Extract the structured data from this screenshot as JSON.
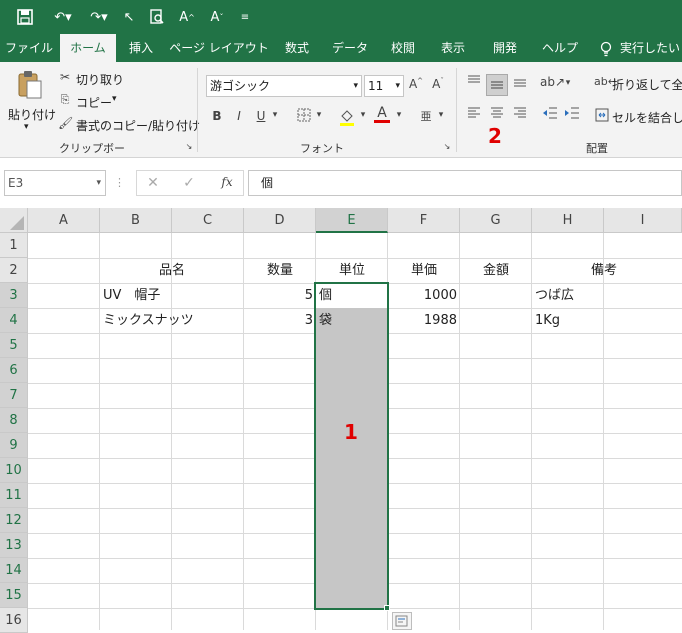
{
  "tabs": [
    "ファイル",
    "ホーム",
    "挿入",
    "ページ レイアウト",
    "数式",
    "データ",
    "校閲",
    "表示",
    "開発",
    "ヘルプ",
    "実行したい"
  ],
  "clipboard": {
    "paste": "貼り付け",
    "cut": "切り取り",
    "copy": "コピー",
    "format_painter": "書式のコピー/貼り付け",
    "group_label": "クリップボード"
  },
  "font": {
    "name": "游ゴシック",
    "size": "11",
    "bold": "B",
    "italic": "I",
    "underline": "U",
    "group_label": "フォント"
  },
  "alignment": {
    "wrap_text": "折り返して全体",
    "merge": "セルを結合して",
    "group_label": "配置"
  },
  "formula_bar": {
    "name_box": "E3",
    "fx": "fx",
    "content": "個"
  },
  "columns": [
    "A",
    "B",
    "C",
    "D",
    "E",
    "F",
    "G",
    "H",
    "I"
  ],
  "rows": [
    "1",
    "2",
    "3",
    "4",
    "5",
    "6",
    "7",
    "8",
    "9",
    "10",
    "11",
    "12",
    "13",
    "14",
    "15",
    "16"
  ],
  "cells": {
    "b2": "品名",
    "d2": "数量",
    "e2": "単位",
    "f2": "単価",
    "g2": "金額",
    "h2": "備考",
    "b3": "UV　帽子",
    "d3": "5",
    "e3": "個",
    "f3": "1000",
    "h3": "つば広",
    "b4": "ミックスナッツ",
    "d4": "3",
    "e4": "袋",
    "f4": "1988",
    "h4": "1Kg"
  },
  "annotations": {
    "marker_1": "1",
    "marker_2": "2"
  },
  "colors": {
    "accent": "#217346",
    "selection": "#c6c6c6",
    "marker": "#e00000"
  }
}
